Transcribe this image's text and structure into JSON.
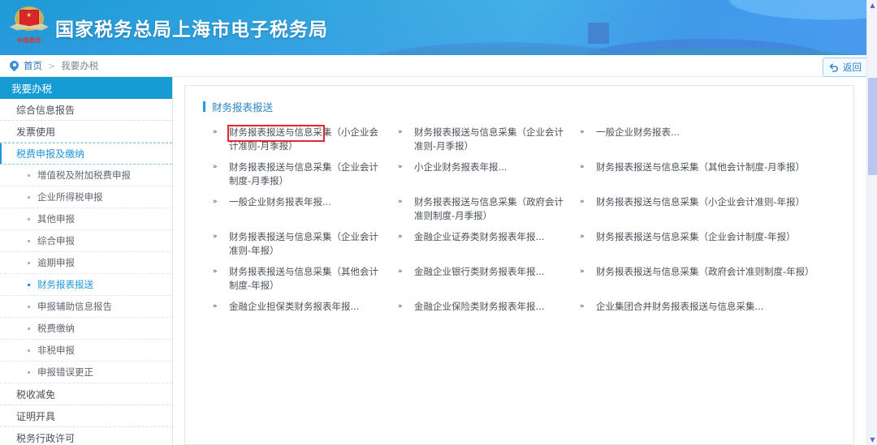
{
  "header": {
    "title": "国家税务总局上海市电子税务局",
    "emblem_text": "中国税务",
    "emblem_name": "national-tax-emblem"
  },
  "breadcrumb": {
    "home": "首页",
    "separator": ">",
    "current": "我要办税"
  },
  "return_button": {
    "label": "返回",
    "icon": "back-arrow-icon"
  },
  "sidebar": {
    "header": "我要办税",
    "items": [
      {
        "label": "综合信息报告",
        "level": 1,
        "state": "normal"
      },
      {
        "label": "发票使用",
        "level": 1,
        "state": "normal"
      },
      {
        "label": "税费申报及缴纳",
        "level": 1,
        "state": "active"
      },
      {
        "label": "增值税及附加税费申报",
        "level": 2,
        "state": "normal"
      },
      {
        "label": "企业所得税申报",
        "level": 2,
        "state": "normal"
      },
      {
        "label": "其他申报",
        "level": 2,
        "state": "normal"
      },
      {
        "label": "综合申报",
        "level": 2,
        "state": "normal"
      },
      {
        "label": "逾期申报",
        "level": 2,
        "state": "normal"
      },
      {
        "label": "财务报表报送",
        "level": 2,
        "state": "selected"
      },
      {
        "label": "申报辅助信息报告",
        "level": 2,
        "state": "normal"
      },
      {
        "label": "税费缴纳",
        "level": 2,
        "state": "normal"
      },
      {
        "label": "非税申报",
        "level": 2,
        "state": "normal"
      },
      {
        "label": "申报错误更正",
        "level": 2,
        "state": "normal"
      },
      {
        "label": "税收减免",
        "level": 1,
        "state": "normal"
      },
      {
        "label": "证明开具",
        "level": 1,
        "state": "normal"
      },
      {
        "label": "税务行政许可",
        "level": 1,
        "state": "normal"
      }
    ]
  },
  "content": {
    "section_title": "财务报表报送",
    "rows": [
      [
        {
          "label": "财务报表报送与信息采集（小企业会计准则-月季报）",
          "highlighted": true,
          "truncated": true
        },
        {
          "label": "财务报表报送与信息采集（企业会计准则-月季报）",
          "highlighted": false,
          "truncated": true
        },
        {
          "label": "一般企业财务报表...",
          "highlighted": false,
          "truncated": true
        }
      ],
      [
        {
          "label": "财务报表报送与信息采集（企业会计制度-月季报）",
          "highlighted": false,
          "truncated": false
        },
        {
          "label": "小企业财务报表年报...",
          "highlighted": false,
          "truncated": true
        },
        {
          "label": "财务报表报送与信息采集（其他会计制度-月季报）",
          "highlighted": false,
          "truncated": false
        }
      ],
      [
        {
          "label": "一般企业财务报表年报...",
          "highlighted": false,
          "truncated": true
        },
        {
          "label": "财务报表报送与信息采集（政府会计准则制度-月季报）",
          "highlighted": false,
          "truncated": false
        },
        {
          "label": "财务报表报送与信息采集（小企业会计准则-年报）",
          "highlighted": false,
          "truncated": false
        }
      ],
      [
        {
          "label": "财务报表报送与信息采集（企业会计准则-年报）",
          "highlighted": false,
          "truncated": false
        },
        {
          "label": "金融企业证券类财务报表年报...",
          "highlighted": false,
          "truncated": true
        },
        {
          "label": "财务报表报送与信息采集（企业会计制度-年报）",
          "highlighted": false,
          "truncated": false
        }
      ],
      [
        {
          "label": "财务报表报送与信息采集（其他会计制度-年报）",
          "highlighted": false,
          "truncated": false
        },
        {
          "label": "金融企业银行类财务报表年报...",
          "highlighted": false,
          "truncated": true
        },
        {
          "label": "财务报表报送与信息采集（政府会计准则制度-年报）",
          "highlighted": false,
          "truncated": false
        }
      ],
      [
        {
          "label": "金融企业担保类财务报表年报...",
          "highlighted": false,
          "truncated": true
        },
        {
          "label": "金融企业保险类财务报表年报...",
          "highlighted": false,
          "truncated": true
        },
        {
          "label": "企业集团合并财务报表报送与信息采集...",
          "highlighted": false,
          "truncated": true
        }
      ]
    ],
    "bullet_glyph": "»"
  },
  "colors": {
    "brand_blue": "#169bd5",
    "header_blue": "#2aa3dd",
    "link_text": "#4b5158",
    "active_blue": "#2196d6",
    "highlight_red": "#e8262b",
    "scrollbar_thumb": "#b9c6f2"
  }
}
